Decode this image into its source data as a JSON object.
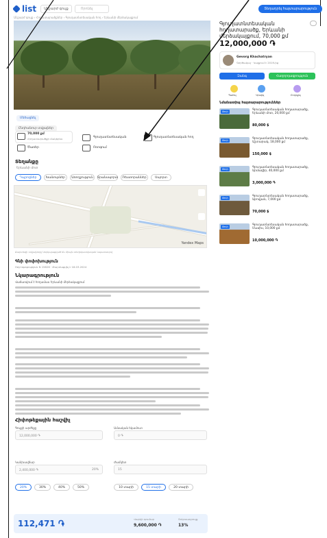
{
  "header": {
    "logo": "list",
    "category_select": "Անշարժ գույք",
    "search_placeholder": "Որոնել",
    "cta": "Տեղադրել հայտարարություն"
  },
  "breadcrumb": "Անշարժ գույք › Հողատարածքներ › Գյուղատնտեսական հող › Երևանի մերձակայքում",
  "gallery": {
    "caption": "Մեծացնել"
  },
  "facts": {
    "section_label": "Ընդհանուր տվյալներ",
    "area_value": "70,000 քմ",
    "area_label": "Հողատարածքի մակերես",
    "purpose": "Գյուղատնտեսական",
    "type": "Գյուղատնտեսական հող",
    "trees": "Ծառեր",
    "water": "Ոռոգում"
  },
  "location": {
    "heading": "Տեղանքը",
    "subtitle": "Երևանի մոտ",
    "tabs": [
      "Դպրոցներ",
      "Խանութներ",
      "Առողջություն",
      "Տրանսպորտ",
      "Ռեստորաններ",
      "Սպորտ"
    ],
    "active_tab": 0,
    "map_brand": "Yandex Maps",
    "map_attribution": "Քարտեզի տվյալները ներկայացված են միայն տեղեկատվական նպատակով"
  },
  "description": {
    "heading": "Նկարագրություն",
    "meta": "Hayтарарություն N 15826 · Թարմացվել է 18.03.2024",
    "subheading": "Վաճառվում է հողամաս Երևանի մերձակայքում",
    "paragraph_count": 6
  },
  "calculator": {
    "heading": "Հիփոթեքային հաշվիչ",
    "price_label": "Գույքի արժեքը",
    "price_value": "12,000,000 ֏",
    "income_label": "Ամսական եկամուտ",
    "income_value": "0 ֏",
    "prepay_label": "Կանխավճար",
    "prepay_value": "2,400,000 ֏",
    "prepay_pct": "20%",
    "term_label": "Ժամկետ",
    "term_value": "15",
    "pct_options": [
      "20%",
      "30%",
      "40%",
      "50%"
    ],
    "active_pct": 0,
    "term_options": [
      "10 տարի",
      "15 տարի",
      "20 տարի"
    ],
    "active_term": 1,
    "monthly": "112,471 ֏",
    "loan_label": "Վարկի գումար",
    "loan": "9,600,000 ֏",
    "rate_label": "Տոկոսադրույք",
    "rate": "13%"
  },
  "sidebar": {
    "title": "Գյուղատնտեսական հողատարածք, Երևանի մերձակայքում, 70,000 քմ",
    "price": "12,000,000 ֏",
    "seller": {
      "name": "Gevorg Khachatryan",
      "note": "Գործակալ · Կայքում է 2019-ից"
    },
    "call": "Զանգ",
    "message": "Հաղորդագրություն",
    "actions": [
      "Պահել",
      "Կիսվել",
      "Բողոքել"
    ],
    "similar_heading": "Նմանատիպ հայտարարություններ",
    "similar": [
      {
        "badge": "Թոփ",
        "title": "Գյուղատնտեսական հողատարածք, Երևանի մոտ, 20,000 քմ",
        "price": "80,000 $"
      },
      {
        "badge": "Թոփ",
        "title": "Գյուղատնտեսական հողատարածք, Աշտարակ, 18,000 քմ",
        "price": "150,000 $"
      },
      {
        "badge": "Թոփ",
        "title": "Գյուղատնտեսական հողատարածք, Արմավիր, 40,000 քմ",
        "price": "3,000,000 ֏"
      },
      {
        "badge": "Թոփ",
        "title": "Գյուղատնտեսական հողատարածք, Աբովյան, 7,000 քմ",
        "price": "70,000 $"
      },
      {
        "badge": "Թոփ",
        "title": "Գյուղատնտեսական հողատարածք, Մասիս, 10,000 քմ",
        "price": "10,000,000 ֏"
      }
    ]
  },
  "colors": {
    "accent": "#1f6fe8",
    "call": "#1f6fe8",
    "message": "#2dc25a"
  }
}
